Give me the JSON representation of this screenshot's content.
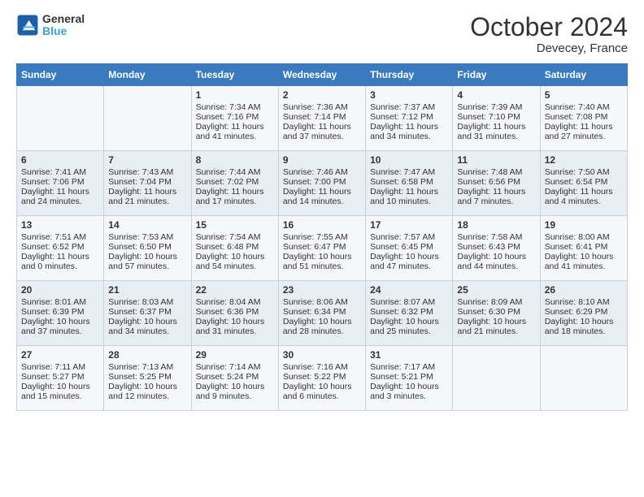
{
  "header": {
    "logo_line1": "General",
    "logo_line2": "Blue",
    "title": "October 2024",
    "subtitle": "Devecey, France"
  },
  "weekdays": [
    "Sunday",
    "Monday",
    "Tuesday",
    "Wednesday",
    "Thursday",
    "Friday",
    "Saturday"
  ],
  "weeks": [
    [
      {
        "day": "",
        "sunrise": "",
        "sunset": "",
        "daylight": ""
      },
      {
        "day": "",
        "sunrise": "",
        "sunset": "",
        "daylight": ""
      },
      {
        "day": "1",
        "sunrise": "Sunrise: 7:34 AM",
        "sunset": "Sunset: 7:16 PM",
        "daylight": "Daylight: 11 hours and 41 minutes."
      },
      {
        "day": "2",
        "sunrise": "Sunrise: 7:36 AM",
        "sunset": "Sunset: 7:14 PM",
        "daylight": "Daylight: 11 hours and 37 minutes."
      },
      {
        "day": "3",
        "sunrise": "Sunrise: 7:37 AM",
        "sunset": "Sunset: 7:12 PM",
        "daylight": "Daylight: 11 hours and 34 minutes."
      },
      {
        "day": "4",
        "sunrise": "Sunrise: 7:39 AM",
        "sunset": "Sunset: 7:10 PM",
        "daylight": "Daylight: 11 hours and 31 minutes."
      },
      {
        "day": "5",
        "sunrise": "Sunrise: 7:40 AM",
        "sunset": "Sunset: 7:08 PM",
        "daylight": "Daylight: 11 hours and 27 minutes."
      }
    ],
    [
      {
        "day": "6",
        "sunrise": "Sunrise: 7:41 AM",
        "sunset": "Sunset: 7:06 PM",
        "daylight": "Daylight: 11 hours and 24 minutes."
      },
      {
        "day": "7",
        "sunrise": "Sunrise: 7:43 AM",
        "sunset": "Sunset: 7:04 PM",
        "daylight": "Daylight: 11 hours and 21 minutes."
      },
      {
        "day": "8",
        "sunrise": "Sunrise: 7:44 AM",
        "sunset": "Sunset: 7:02 PM",
        "daylight": "Daylight: 11 hours and 17 minutes."
      },
      {
        "day": "9",
        "sunrise": "Sunrise: 7:46 AM",
        "sunset": "Sunset: 7:00 PM",
        "daylight": "Daylight: 11 hours and 14 minutes."
      },
      {
        "day": "10",
        "sunrise": "Sunrise: 7:47 AM",
        "sunset": "Sunset: 6:58 PM",
        "daylight": "Daylight: 11 hours and 10 minutes."
      },
      {
        "day": "11",
        "sunrise": "Sunrise: 7:48 AM",
        "sunset": "Sunset: 6:56 PM",
        "daylight": "Daylight: 11 hours and 7 minutes."
      },
      {
        "day": "12",
        "sunrise": "Sunrise: 7:50 AM",
        "sunset": "Sunset: 6:54 PM",
        "daylight": "Daylight: 11 hours and 4 minutes."
      }
    ],
    [
      {
        "day": "13",
        "sunrise": "Sunrise: 7:51 AM",
        "sunset": "Sunset: 6:52 PM",
        "daylight": "Daylight: 11 hours and 0 minutes."
      },
      {
        "day": "14",
        "sunrise": "Sunrise: 7:53 AM",
        "sunset": "Sunset: 6:50 PM",
        "daylight": "Daylight: 10 hours and 57 minutes."
      },
      {
        "day": "15",
        "sunrise": "Sunrise: 7:54 AM",
        "sunset": "Sunset: 6:48 PM",
        "daylight": "Daylight: 10 hours and 54 minutes."
      },
      {
        "day": "16",
        "sunrise": "Sunrise: 7:55 AM",
        "sunset": "Sunset: 6:47 PM",
        "daylight": "Daylight: 10 hours and 51 minutes."
      },
      {
        "day": "17",
        "sunrise": "Sunrise: 7:57 AM",
        "sunset": "Sunset: 6:45 PM",
        "daylight": "Daylight: 10 hours and 47 minutes."
      },
      {
        "day": "18",
        "sunrise": "Sunrise: 7:58 AM",
        "sunset": "Sunset: 6:43 PM",
        "daylight": "Daylight: 10 hours and 44 minutes."
      },
      {
        "day": "19",
        "sunrise": "Sunrise: 8:00 AM",
        "sunset": "Sunset: 6:41 PM",
        "daylight": "Daylight: 10 hours and 41 minutes."
      }
    ],
    [
      {
        "day": "20",
        "sunrise": "Sunrise: 8:01 AM",
        "sunset": "Sunset: 6:39 PM",
        "daylight": "Daylight: 10 hours and 37 minutes."
      },
      {
        "day": "21",
        "sunrise": "Sunrise: 8:03 AM",
        "sunset": "Sunset: 6:37 PM",
        "daylight": "Daylight: 10 hours and 34 minutes."
      },
      {
        "day": "22",
        "sunrise": "Sunrise: 8:04 AM",
        "sunset": "Sunset: 6:36 PM",
        "daylight": "Daylight: 10 hours and 31 minutes."
      },
      {
        "day": "23",
        "sunrise": "Sunrise: 8:06 AM",
        "sunset": "Sunset: 6:34 PM",
        "daylight": "Daylight: 10 hours and 28 minutes."
      },
      {
        "day": "24",
        "sunrise": "Sunrise: 8:07 AM",
        "sunset": "Sunset: 6:32 PM",
        "daylight": "Daylight: 10 hours and 25 minutes."
      },
      {
        "day": "25",
        "sunrise": "Sunrise: 8:09 AM",
        "sunset": "Sunset: 6:30 PM",
        "daylight": "Daylight: 10 hours and 21 minutes."
      },
      {
        "day": "26",
        "sunrise": "Sunrise: 8:10 AM",
        "sunset": "Sunset: 6:29 PM",
        "daylight": "Daylight: 10 hours and 18 minutes."
      }
    ],
    [
      {
        "day": "27",
        "sunrise": "Sunrise: 7:11 AM",
        "sunset": "Sunset: 5:27 PM",
        "daylight": "Daylight: 10 hours and 15 minutes."
      },
      {
        "day": "28",
        "sunrise": "Sunrise: 7:13 AM",
        "sunset": "Sunset: 5:25 PM",
        "daylight": "Daylight: 10 hours and 12 minutes."
      },
      {
        "day": "29",
        "sunrise": "Sunrise: 7:14 AM",
        "sunset": "Sunset: 5:24 PM",
        "daylight": "Daylight: 10 hours and 9 minutes."
      },
      {
        "day": "30",
        "sunrise": "Sunrise: 7:16 AM",
        "sunset": "Sunset: 5:22 PM",
        "daylight": "Daylight: 10 hours and 6 minutes."
      },
      {
        "day": "31",
        "sunrise": "Sunrise: 7:17 AM",
        "sunset": "Sunset: 5:21 PM",
        "daylight": "Daylight: 10 hours and 3 minutes."
      },
      {
        "day": "",
        "sunrise": "",
        "sunset": "",
        "daylight": ""
      },
      {
        "day": "",
        "sunrise": "",
        "sunset": "",
        "daylight": ""
      }
    ]
  ]
}
